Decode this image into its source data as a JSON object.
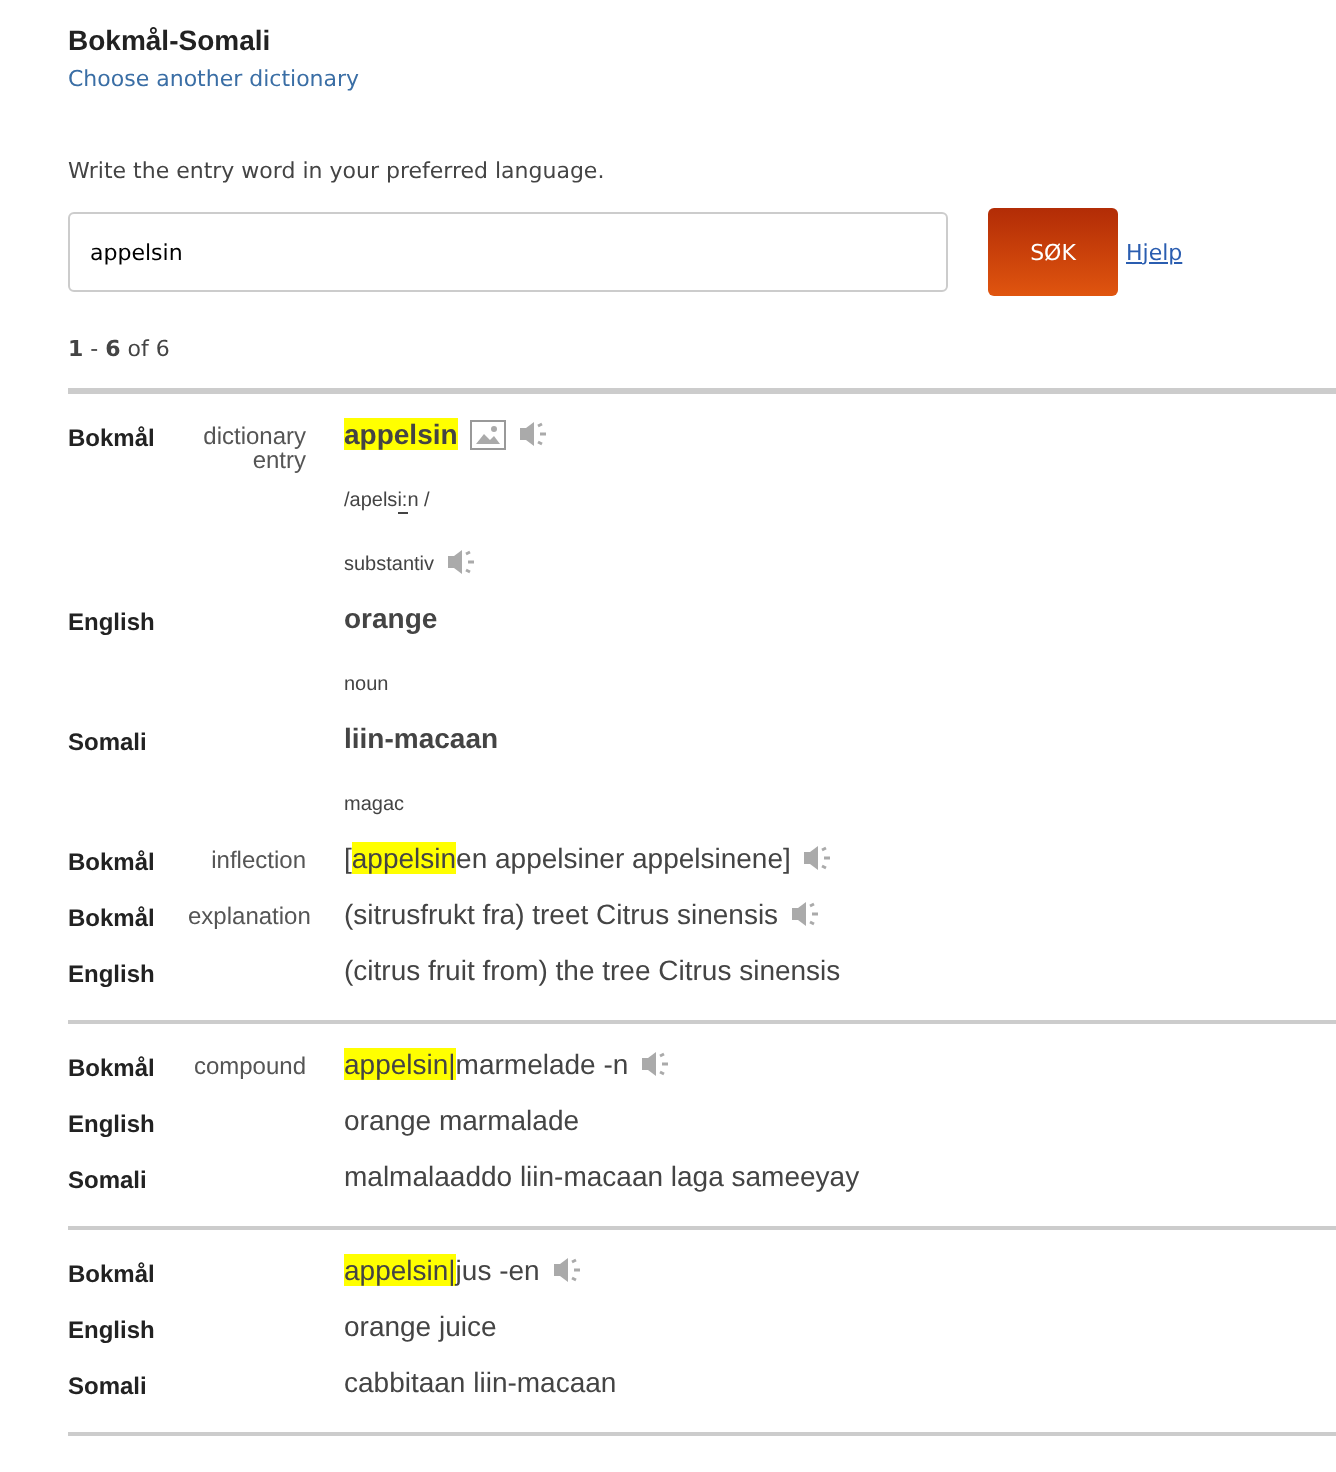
{
  "title": "Bokmål-Somali",
  "choose_link": "Choose another dictionary",
  "instruction": "Write the entry word in your preferred language.",
  "search": {
    "value": "appelsin",
    "button": "SØK",
    "help": "Hjelp"
  },
  "result_count": {
    "from": "1",
    "to": "6",
    "sep": " - ",
    "of": " of 6"
  },
  "entries": [
    {
      "rows": [
        {
          "lang": "Bokmål",
          "type": "dictionary entry",
          "kind": "headword",
          "image": true,
          "speaker": true,
          "segments": [
            {
              "text": "appelsin",
              "highlighted": true,
              "underlined": false
            }
          ]
        },
        {
          "kind": "gram",
          "segments": [
            {
              "text": "/apels",
              "highlighted": false,
              "underlined": false
            },
            {
              "text": "i:",
              "highlighted": false,
              "underlined": true
            },
            {
              "text": "n /",
              "highlighted": false,
              "underlined": false
            }
          ]
        },
        {
          "kind": "gram",
          "speaker": true,
          "segments": [
            {
              "text": "substantiv",
              "highlighted": false,
              "underlined": false
            }
          ]
        },
        {
          "lang": "English",
          "kind": "headword",
          "segments": [
            {
              "text": "orange",
              "highlighted": false,
              "underlined": false
            }
          ]
        },
        {
          "kind": "gram",
          "segments": [
            {
              "text": "noun",
              "highlighted": false,
              "underlined": false
            }
          ]
        },
        {
          "lang": "Somali",
          "kind": "headword",
          "segments": [
            {
              "text": "liin-macaan",
              "highlighted": false,
              "underlined": false
            }
          ]
        },
        {
          "kind": "gram",
          "segments": [
            {
              "text": "magac",
              "highlighted": false,
              "underlined": false
            }
          ]
        },
        {
          "lang": "Bokmål",
          "type": "inflection",
          "kind": "text",
          "speaker": true,
          "segments": [
            {
              "text": "[",
              "highlighted": false,
              "underlined": false
            },
            {
              "text": "appelsin",
              "highlighted": true,
              "underlined": false
            },
            {
              "text": "en appelsiner appelsinene]",
              "highlighted": false,
              "underlined": false
            }
          ]
        },
        {
          "lang": "Bokmål",
          "type": "explanation",
          "kind": "text",
          "speaker": true,
          "segments": [
            {
              "text": "(sitrusfrukt fra) treet Citrus sinensis",
              "highlighted": false,
              "underlined": false
            }
          ]
        },
        {
          "lang": "English",
          "kind": "text",
          "segments": [
            {
              "text": "(citrus fruit from) the tree Citrus sinensis",
              "highlighted": false,
              "underlined": false
            }
          ]
        }
      ]
    },
    {
      "rows": [
        {
          "lang": "Bokmål",
          "type": "compound",
          "kind": "text",
          "speaker": true,
          "segments": [
            {
              "text": "appelsin|",
              "highlighted": true,
              "underlined": false
            },
            {
              "text": "marmelade -n",
              "highlighted": false,
              "underlined": false
            }
          ]
        },
        {
          "lang": "English",
          "kind": "text",
          "segments": [
            {
              "text": "orange marmalade",
              "highlighted": false,
              "underlined": false
            }
          ]
        },
        {
          "lang": "Somali",
          "kind": "text",
          "segments": [
            {
              "text": "malmalaaddo liin-macaan laga sameeyay",
              "highlighted": false,
              "underlined": false
            }
          ]
        }
      ]
    },
    {
      "rows": [
        {
          "lang": "Bokmål",
          "kind": "text",
          "speaker": true,
          "segments": [
            {
              "text": "appelsin|",
              "highlighted": true,
              "underlined": false
            },
            {
              "text": "jus -en",
              "highlighted": false,
              "underlined": false
            }
          ]
        },
        {
          "lang": "English",
          "kind": "text",
          "segments": [
            {
              "text": "orange juice",
              "highlighted": false,
              "underlined": false
            }
          ]
        },
        {
          "lang": "Somali",
          "kind": "text",
          "segments": [
            {
              "text": "cabbitaan liin-macaan",
              "highlighted": false,
              "underlined": false
            }
          ]
        }
      ]
    }
  ]
}
